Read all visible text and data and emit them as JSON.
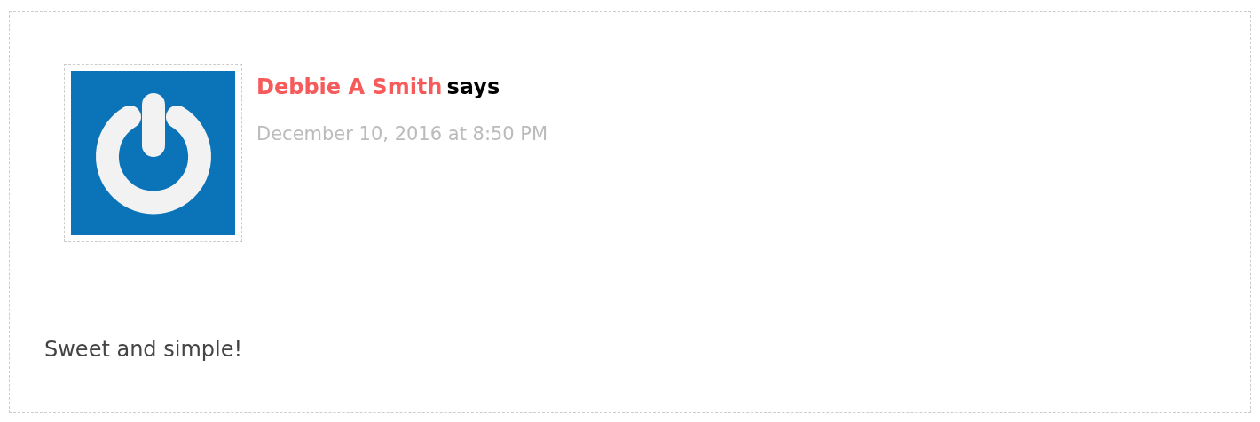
{
  "comment": {
    "author": "Debbie A Smith",
    "says": "says",
    "date": "December 10, 2016 at 8:50 PM",
    "text": "Sweet and simple!"
  }
}
